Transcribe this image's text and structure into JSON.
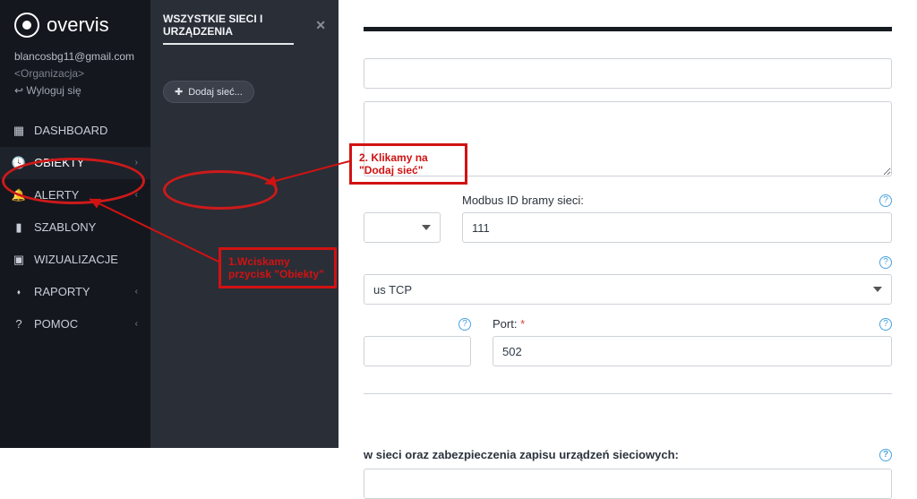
{
  "brand": "overvis",
  "user": {
    "email": "blancosbg11@gmail.com",
    "org": "<Organizacja>",
    "logout": "Wyloguj się"
  },
  "nav": {
    "dashboard": "DASHBOARD",
    "obiekty": "OBIEKTY",
    "alerty": "ALERTY",
    "szablony": "SZABLONY",
    "wizualizacje": "WIZUALIZACJE",
    "raporty": "RAPORTY",
    "pomoc": "POMOC"
  },
  "panel": {
    "title": "WSZYSTKIE SIECI I URZĄDZENIA",
    "add": "Dodaj sieć..."
  },
  "annot1": "1.Wciskamy przycisk \"Obiekty\"",
  "annot2": "2. Klikamy na \"Dodaj sieć\"",
  "form": {
    "modbus_label": "Modbus ID bramy sieci:",
    "modbus_value": "111",
    "proto_value": "us TCP",
    "port_label": "Port:",
    "port_value": "502",
    "section": "w sieci oraz zabezpieczenia zapisu urządzeń sieciowych:"
  }
}
